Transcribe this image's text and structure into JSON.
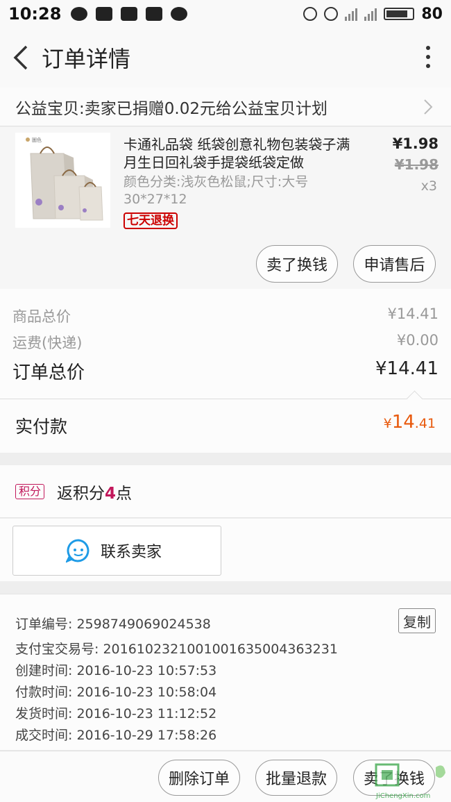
{
  "status_bar": {
    "time": "10:28",
    "battery_pct": "80"
  },
  "header": {
    "title": "订单详情"
  },
  "charity": {
    "text": "公益宝贝:卖家已捐赠0.02元给公益宝贝计划"
  },
  "product": {
    "thumb_label": "圖色",
    "name": "卡通礼品袋 纸袋创意礼物包装袋子满月生日回礼袋手提袋纸袋定做",
    "sku": "颜色分类:浅灰色松鼠;尺寸:大号30*27*12",
    "tag": "七天退换",
    "price": "¥1.98",
    "original_price": "¥1.98",
    "quantity": "x3",
    "sell_button": "卖了换钱",
    "aftersale_button": "申请售后"
  },
  "totals": {
    "goods_label": "商品总价",
    "goods_value": "¥14.41",
    "shipping_label": "运费(快递)",
    "shipping_value": "¥0.00",
    "order_label": "订单总价",
    "order_value": "¥14.41"
  },
  "paid": {
    "label": "实付款",
    "symbol": "¥",
    "integer": "14",
    "decimal": ".41"
  },
  "points": {
    "badge": "积分",
    "prefix": "返积分",
    "value": "4",
    "suffix": "点"
  },
  "contact": {
    "label": "联系卖家"
  },
  "order_info": {
    "order_no": "订单编号: 2598749069024538",
    "alipay_no": "支付宝交易号: 2016102321001001635004363231",
    "created": "创建时间: 2016-10-23 10:57:53",
    "paid_time": "付款时间: 2016-10-23 10:58:04",
    "shipped": "发货时间: 2016-10-23 11:12:52",
    "completed": "成交时间: 2016-10-29 17:58:26",
    "copy_button": "复制"
  },
  "actions": {
    "delete": "删除订单",
    "batch_refund": "批量退款",
    "sell": "卖了换钱"
  },
  "watermark": {
    "text": "JiChengXin.com"
  },
  "colors": {
    "accent_orange": "#e8590c",
    "points_pink": "#c2185b",
    "tag_red": "#cc0000",
    "contact_blue": "#1e9be6"
  }
}
